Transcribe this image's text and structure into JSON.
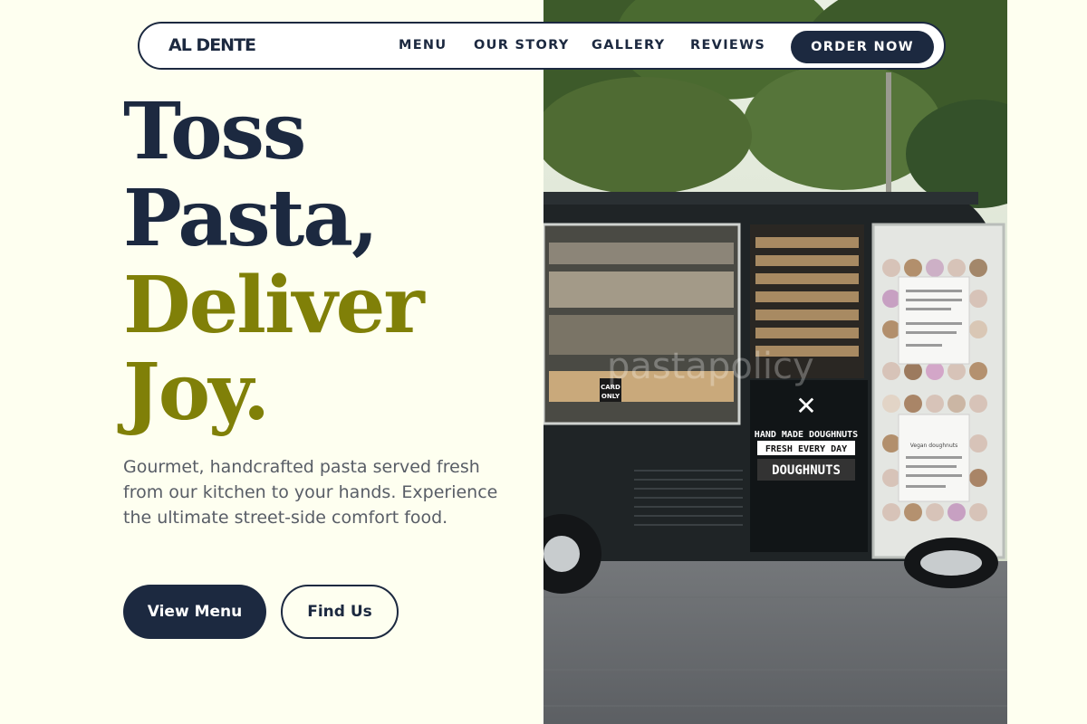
{
  "nav": {
    "brand": "AL DENTE",
    "links": [
      "MENU",
      "OUR STORY",
      "GALLERY",
      "REVIEWS"
    ],
    "cta": "ORDER NOW"
  },
  "hero": {
    "headline": {
      "line1": "Toss",
      "line2": "Pasta,",
      "line3": "Deliver",
      "line4": "Joy."
    },
    "tagline": "Gourmet, handcrafted pasta served fresh from our kitchen to your hands. Experience the ultimate street-side comfort food.",
    "buttons": {
      "primary": "View Menu",
      "secondary": "Find Us"
    }
  },
  "photo": {
    "truck_sign_line1": "HAND MADE DOUGHNUTS",
    "truck_sign_line2": "FRESH EVERY DAY",
    "truck_sign_line3": "DOUGHNUTS",
    "card_sign": "CARD ONLY",
    "watermark": "pastapolicy",
    "poster_heading": "Vegan doughnuts"
  },
  "colors": {
    "background": "#fefff0",
    "navy": "#1c2940",
    "olive": "#808008",
    "text_muted": "#585d66"
  }
}
